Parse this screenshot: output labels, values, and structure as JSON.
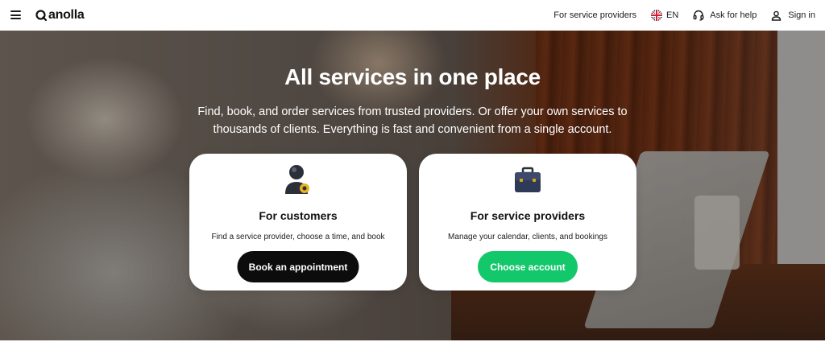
{
  "header": {
    "brand": "anolla",
    "nav": {
      "service_providers": "For service providers",
      "language": "EN",
      "help": "Ask for help",
      "sign_in": "Sign in"
    }
  },
  "hero": {
    "title": "All services in one place",
    "subtitle": "Find, book, and order services from trusted providers. Or offer your own services to thousands of clients. Everything is fast and convenient from a single account."
  },
  "cards": {
    "customers": {
      "icon": "user-avatar-icon",
      "title": "For customers",
      "description": "Find a service provider, choose a time, and book",
      "button": "Book an appointment"
    },
    "providers": {
      "icon": "briefcase-icon",
      "title": "For service providers",
      "description": "Manage your calendar, clients, and bookings",
      "button": "Choose account"
    }
  },
  "colors": {
    "accent_green": "#13c86a",
    "primary_black": "#0c0c0c"
  }
}
